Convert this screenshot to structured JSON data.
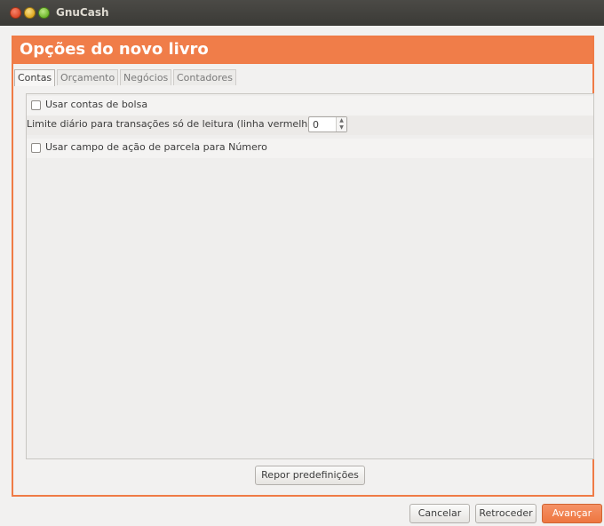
{
  "window": {
    "title": "GnuCash"
  },
  "dialog": {
    "heading": "Opções do novo livro",
    "tabs": [
      "Contas",
      "Orçamento",
      "Negócios",
      "Contadores"
    ],
    "active_tab": "Contas",
    "options": {
      "trading_accounts_label": "Usar contas de bolsa",
      "trading_accounts_checked": false,
      "read_only_threshold_label": "Limite diário para transações só de leitura (linha vermelha):",
      "read_only_threshold_value": "0",
      "split_action_label": "Usar campo de ação de parcela para Número",
      "split_action_checked": false
    },
    "reset_label": "Repor predefinições"
  },
  "buttons": {
    "cancel": "Cancelar",
    "back": "Retroceder",
    "next": "Avançar"
  },
  "colors": {
    "accent": "#f07d49",
    "titlebar": "#3c3b37"
  }
}
